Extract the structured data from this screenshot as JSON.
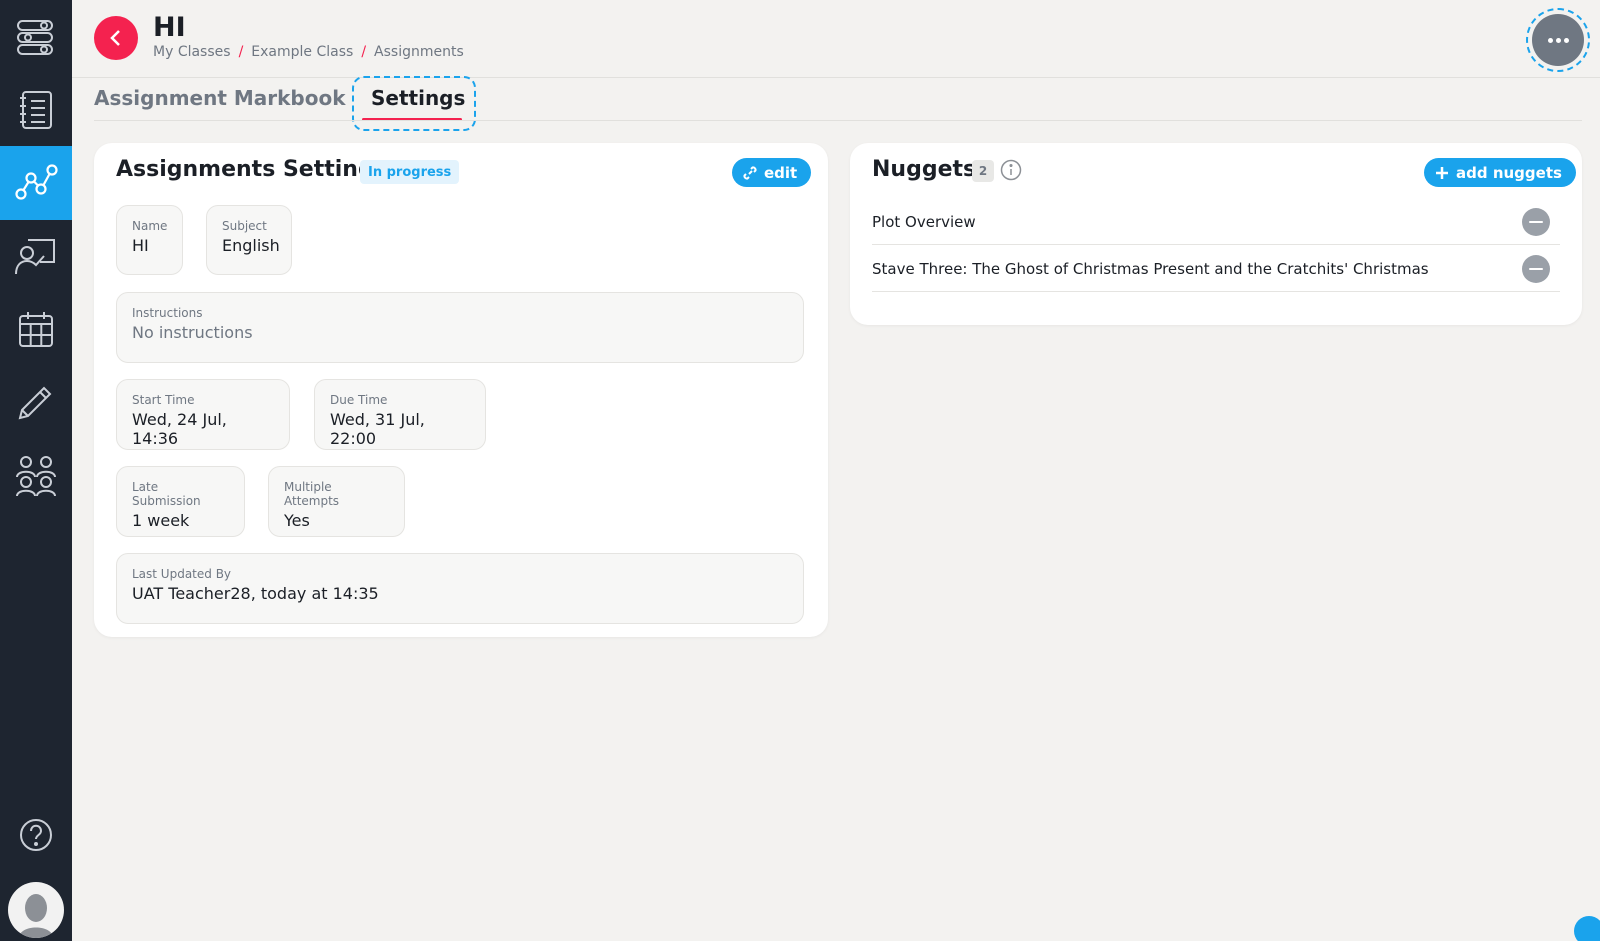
{
  "header": {
    "title": "HI",
    "breadcrumb": [
      {
        "label": "My Classes"
      },
      {
        "label": "Example Class"
      },
      {
        "label": "Assignments"
      }
    ]
  },
  "tabs": [
    {
      "label": "Assignment Markbook",
      "active": false
    },
    {
      "label": "Settings",
      "active": true
    }
  ],
  "settings_card": {
    "title": "Assignments Settings",
    "status": "In progress",
    "edit_label": "edit",
    "fields": {
      "name": {
        "label": "Name",
        "value": "HI"
      },
      "subject": {
        "label": "Subject",
        "value": "English"
      },
      "instructions": {
        "label": "Instructions",
        "value": "No instructions"
      },
      "start_time": {
        "label": "Start Time",
        "value": "Wed, 24 Jul, 14:36"
      },
      "due_time": {
        "label": "Due Time",
        "value": "Wed, 31 Jul, 22:00"
      },
      "late_submission": {
        "label": "Late Submission",
        "value": "1 week"
      },
      "multiple_attempts": {
        "label": "Multiple Attempts",
        "value": "Yes"
      },
      "last_updated": {
        "label": "Last Updated By",
        "value": "UAT Teacher28, today at 14:35"
      }
    }
  },
  "nuggets_card": {
    "title": "Nuggets",
    "count": "2",
    "add_label": "add nuggets",
    "items": [
      {
        "label": "Plot Overview"
      },
      {
        "label": "Stave Three: The Ghost of Christmas Present and the Cratchits' Christmas"
      }
    ]
  },
  "sidebar": {
    "items": [
      {
        "icon": "workflow-icon"
      },
      {
        "icon": "notebook-icon"
      },
      {
        "icon": "graph-nodes-icon",
        "active": true
      },
      {
        "icon": "teacher-board-icon"
      },
      {
        "icon": "calendar-icon"
      },
      {
        "icon": "pencil-icon"
      },
      {
        "icon": "people-group-icon"
      }
    ]
  },
  "colors": {
    "sidebar_bg": "#1e2530",
    "accent_blue": "#1aa3ec",
    "accent_red": "#f4224f",
    "page_bg": "#f3f2f0"
  }
}
